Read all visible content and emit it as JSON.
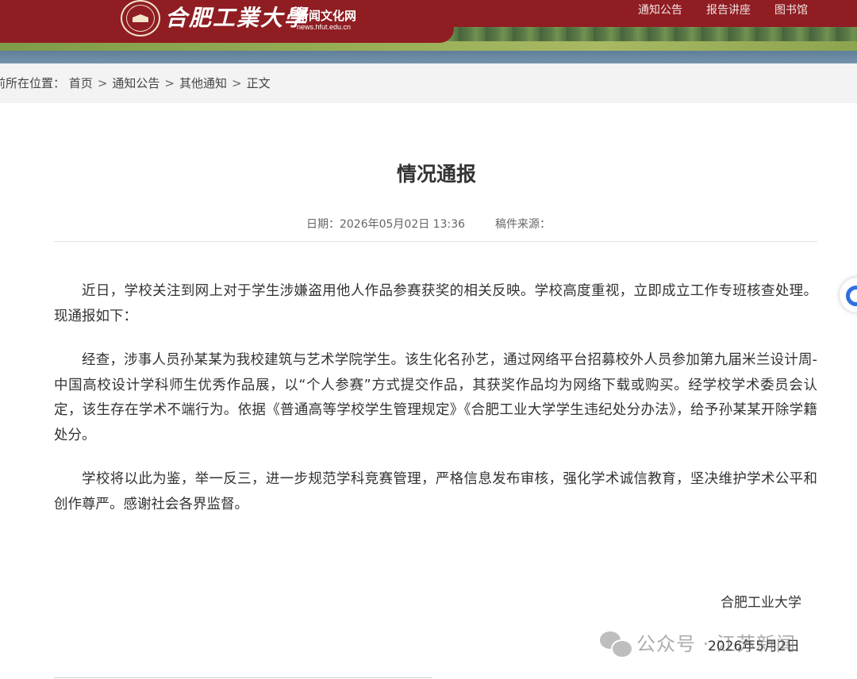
{
  "header": {
    "school_name": "合肥工業大學",
    "site_name": "新闻文化网",
    "site_url": "news.hfut.edu.cn",
    "nav": [
      {
        "label": "通知公告"
      },
      {
        "label": "报告讲座"
      },
      {
        "label": "图书馆"
      }
    ]
  },
  "breadcrumb": {
    "prefix": "前所在位置：",
    "items": [
      {
        "label": "首页"
      },
      {
        "label": "通知公告"
      },
      {
        "label": "其他通知"
      },
      {
        "label": "正文"
      }
    ],
    "separator": ">"
  },
  "article": {
    "title": "情况通报",
    "date": "日期：2026年05月02日 13:36",
    "source": "稿件来源：",
    "paragraphs": [
      "近日，学校关注到网上对于学生涉嫌盗用他人作品参赛获奖的相关反映。学校高度重视，立即成立工作专班核查处理。现通报如下：",
      "经查，涉事人员孙某某为我校建筑与艺术学院学生。该生化名孙艺，通过网络平台招募校外人员参加第九届米兰设计周-中国高校设计学科师生优秀作品展，以“个人参赛”方式提交作品，其获奖作品均为网络下载或购买。经学校学术委员会认定，该生存在学术不端行为。依据《普通高等学校学生管理规定》《合肥工业大学学生违纪处分办法》，给予孙某某开除学籍处分。",
      "学校将以此为鉴，举一反三，进一步规范学科竞赛管理，严格信息发布审核，强化学术诚信教育，坚决维护学术公平和创作尊严。感谢社会各界监督。"
    ],
    "signature_org": "合肥工业大学",
    "signature_date": "2026年5月2日"
  },
  "watermark": {
    "icon": "wechat-icon",
    "text": "公众号 · 江苏新闻"
  },
  "colors": {
    "brand_red": "#8f1d22",
    "widget_blue": "#2f6fe0"
  }
}
